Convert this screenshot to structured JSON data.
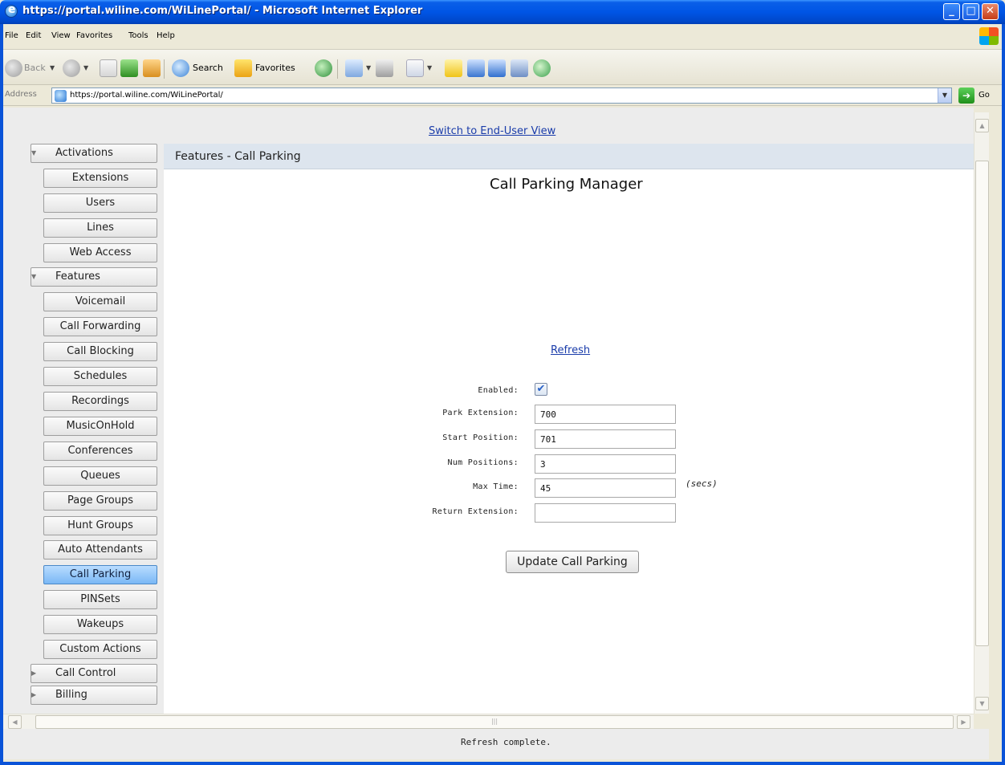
{
  "window": {
    "title": "https://portal.wiline.com/WiLinePortal/ - Microsoft Internet Explorer",
    "min_glyph": "_",
    "max_glyph": "□",
    "close_glyph": "✕"
  },
  "menu": {
    "items": [
      "File",
      "Edit",
      "View",
      "Favorites",
      "Tools",
      "Help"
    ]
  },
  "toolbar": {
    "back_label": "Back",
    "search_label": "Search",
    "favorites_label": "Favorites"
  },
  "address": {
    "label": "Address",
    "url": "https://portal.wiline.com/WiLinePortal/",
    "go_label": "Go"
  },
  "content": {
    "switch_link": "Switch to End-User View"
  },
  "sidebar": {
    "activations": {
      "label": "Activations",
      "items": [
        "Extensions",
        "Users",
        "Lines",
        "Web Access"
      ]
    },
    "features": {
      "label": "Features",
      "items": [
        "Voicemail",
        "Call Forwarding",
        "Call Blocking",
        "Schedules",
        "Recordings",
        "MusicOnHold",
        "Conferences",
        "Queues",
        "Page Groups",
        "Hunt Groups",
        "Auto Attendants",
        "Call Parking",
        "PINSets",
        "Wakeups",
        "Custom Actions"
      ],
      "active": "Call Parking"
    },
    "call_control": {
      "label": "Call Control"
    },
    "billing": {
      "label": "Billing"
    }
  },
  "panel": {
    "header": "Features - Call Parking",
    "title": "Call Parking Manager",
    "refresh_link": "Refresh",
    "form": {
      "enabled_label": "Enabled:",
      "enabled_checked": true,
      "park_extension_label": "Park Extension:",
      "park_extension_value": "700",
      "start_position_label": "Start Position:",
      "start_position_value": "701",
      "num_positions_label": "Num Positions:",
      "num_positions_value": "3",
      "max_time_label": "Max Time:",
      "max_time_value": "45",
      "max_time_unit": "(secs)",
      "return_extension_label": "Return Extension:",
      "return_extension_value": ""
    },
    "update_button": "Update Call Parking"
  },
  "status": {
    "text": "Refresh complete."
  },
  "colors": {
    "titlebar": "#0055e5",
    "link": "#1a3caa",
    "active_nav": "#7ab8f5",
    "panel_header": "#dde5ee"
  }
}
